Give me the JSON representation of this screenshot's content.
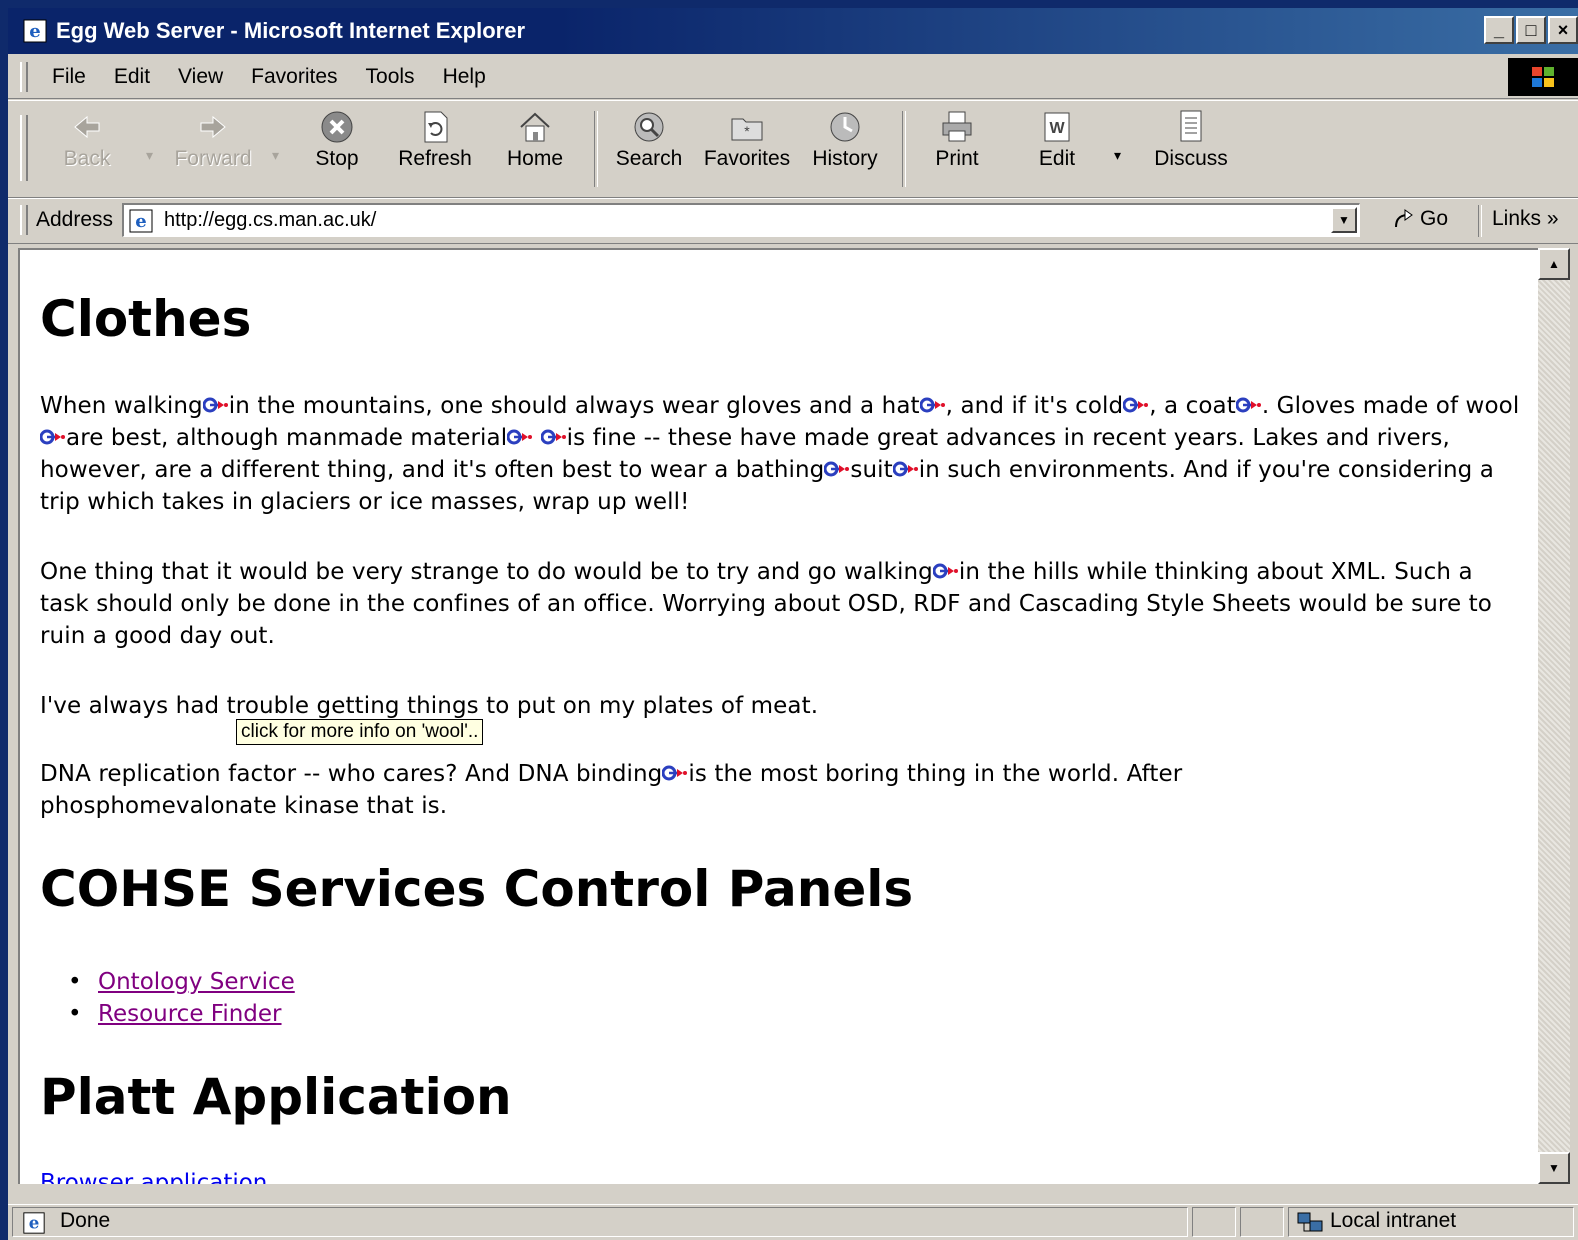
{
  "window": {
    "title": "Egg Web Server - Microsoft Internet Explorer",
    "controls": {
      "minimize": "_",
      "maximize": "□",
      "close": "×"
    }
  },
  "menu": {
    "items": [
      {
        "label": "File"
      },
      {
        "label": "Edit"
      },
      {
        "label": "View"
      },
      {
        "label": "Favorites"
      },
      {
        "label": "Tools"
      },
      {
        "label": "Help"
      }
    ]
  },
  "toolbar": {
    "back": "Back",
    "forward": "Forward",
    "stop": "Stop",
    "refresh": "Refresh",
    "home": "Home",
    "search": "Search",
    "favorites": "Favorites",
    "history": "History",
    "print": "Print",
    "edit": "Edit",
    "discuss": "Discuss"
  },
  "address": {
    "label": "Address",
    "url": "http://egg.cs.man.ac.uk/",
    "go": "Go",
    "links": "Links »"
  },
  "page": {
    "heading_clothes": "Clothes",
    "p1": [
      "When walking",
      "in the mountains, one should always wear gloves and a hat",
      ", and if it's cold",
      ", a coat",
      ". Gloves made of wool",
      "are best, although manmade material",
      " ",
      "is fine -- these have made great advances in recent years. Lakes and rivers, however, are a different thing, and it's often best to wear a bathing",
      "suit",
      "in such environments. And if you're considering a trip which takes in glaciers or ice masses, wrap up well!"
    ],
    "p2": [
      "One thing that it would be very strange to do would be to try and go walking",
      "in the hills while thinking about XML. Such a task should only be done in the confines of an office. Worrying about OSD, RDF and Cascading Style Sheets would be sure to ruin a good day out."
    ],
    "p3": "I've always had trouble getting things to put on my plates of meat.",
    "p4": [
      "DNA replication factor -- who cares? And DNA binding",
      "is the most boring thing in the world. After phosphomevalonate kinase that is."
    ],
    "heading_cohse": "COHSE Services Control Panels",
    "cohse_links": [
      "Ontology Service",
      "Resource Finder"
    ],
    "heading_platt": "Platt Application",
    "browser_link": "Browser application",
    "tooltip": "click for more info on 'wool'.."
  },
  "status": {
    "text": "Done",
    "zone": "Local intranet"
  },
  "colors": {
    "title_bar": "#0a246a",
    "visited_link": "#800080",
    "link": "#0000ee",
    "tooltip_bg": "#ffffe1",
    "cohse_icon_blue": "#2b3fbf",
    "cohse_icon_red": "#e0102a"
  },
  "icons": [
    "ie-page-icon",
    "back-arrow-icon",
    "forward-arrow-icon",
    "stop-icon",
    "refresh-icon",
    "home-icon",
    "search-icon",
    "favorites-icon",
    "history-icon",
    "print-icon",
    "word-edit-icon",
    "discuss-icon",
    "go-arrow-icon",
    "cohse-link-icon",
    "local-intranet-icon"
  ]
}
